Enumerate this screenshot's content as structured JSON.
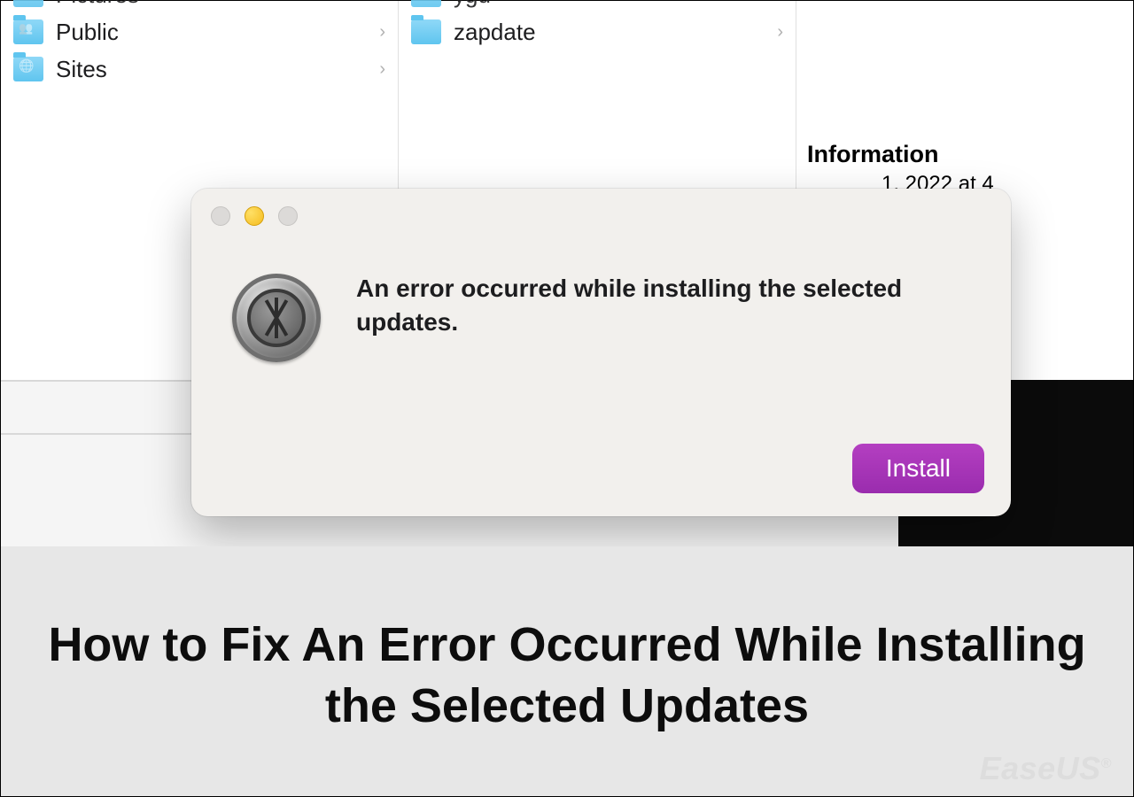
{
  "finder": {
    "col1": [
      {
        "name": "Pictures",
        "partial": true
      },
      {
        "name": "Public"
      },
      {
        "name": "Sites"
      }
    ],
    "col2": [
      {
        "name": "ygu",
        "partial": true
      },
      {
        "name": "zapdate"
      }
    ],
    "info_header": "Information",
    "info_date": "1, 2022 at 4"
  },
  "dialog": {
    "message": "An error occurred while installing the selected updates.",
    "button": "Install"
  },
  "caption": "How to Fix An Error Occurred While Installing the Selected Updates",
  "watermark": "EaseUS",
  "watermark_symbol": "®"
}
